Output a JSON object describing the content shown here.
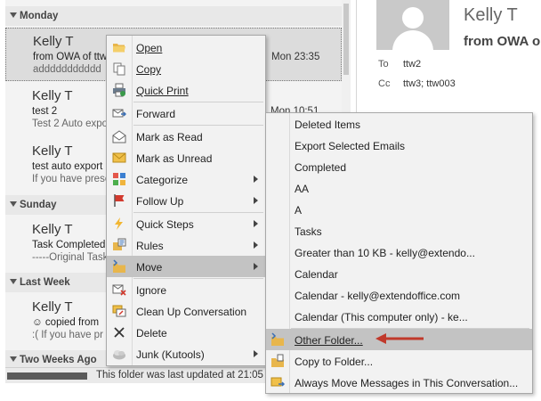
{
  "mail_list": {
    "groups": [
      {
        "label": "Monday"
      },
      {
        "label": "Sunday"
      },
      {
        "label": "Last Week"
      },
      {
        "label": "Two Weeks Ago"
      }
    ],
    "items": [
      {
        "sender": "Kelly T",
        "subject": "from OWA of ttw",
        "preview": "addddddddddd",
        "time": "Mon 23:35"
      },
      {
        "sender": "Kelly T",
        "subject": "test 2",
        "preview": "Test 2  Auto expo",
        "time": "Mon 10:51"
      },
      {
        "sender": "Kelly T",
        "subject": "test auto export",
        "preview": "If you have prese",
        "time": ""
      },
      {
        "sender": "Kelly T",
        "subject": "Task Completed:",
        "preview": "-----Original Task",
        "time": ""
      },
      {
        "sender": "Kelly T",
        "subject": "☺ copied from",
        "preview": ":(  If you have pr",
        "time": ""
      }
    ]
  },
  "reading_pane": {
    "name": "Kelly T",
    "from": "from OWA o",
    "to_label": "To",
    "to_value": "ttw2",
    "cc_label": "Cc",
    "cc_value": "ttw3; ttw003"
  },
  "status_bar": {
    "text": "This folder was last updated at 21:05"
  },
  "context_menu": {
    "items": [
      {
        "label": "Open",
        "icon": "open-folder-icon"
      },
      {
        "label": "Copy",
        "icon": "copy-icon"
      },
      {
        "label": "Quick Print",
        "icon": "quick-print-icon"
      },
      {
        "label": "Forward",
        "icon": "forward-icon"
      },
      {
        "label": "Mark as Read",
        "icon": "mark-read-icon"
      },
      {
        "label": "Mark as Unread",
        "icon": "mark-unread-icon"
      },
      {
        "label": "Categorize",
        "icon": "categorize-icon"
      },
      {
        "label": "Follow Up",
        "icon": "flag-icon"
      },
      {
        "label": "Quick Steps",
        "icon": "lightning-icon"
      },
      {
        "label": "Rules",
        "icon": "rules-icon"
      },
      {
        "label": "Move",
        "icon": "move-folder-icon"
      },
      {
        "label": "Ignore",
        "icon": "ignore-icon"
      },
      {
        "label": "Clean Up Conversation",
        "icon": "clean-up-icon"
      },
      {
        "label": "Delete",
        "icon": "delete-icon"
      },
      {
        "label": "Junk (Kutools)",
        "icon": "junk-icon"
      }
    ]
  },
  "move_submenu": {
    "items": [
      {
        "label": "Deleted Items"
      },
      {
        "label": "Export Selected Emails"
      },
      {
        "label": "Completed"
      },
      {
        "label": "AA"
      },
      {
        "label": "A"
      },
      {
        "label": "Tasks"
      },
      {
        "label": "Greater than 10 KB - kelly@extendo..."
      },
      {
        "label": "Calendar"
      },
      {
        "label": "Calendar - kelly@extendoffice.com"
      },
      {
        "label": "Calendar (This computer only) - ke..."
      },
      {
        "label": "Other Folder...",
        "icon": "other-folder-icon"
      },
      {
        "label": "Copy to Folder...",
        "icon": "copy-to-folder-icon"
      },
      {
        "label": "Always Move Messages in This Conversation...",
        "icon": "always-move-icon"
      }
    ]
  },
  "colors": {
    "highlight": "#c3c3c3",
    "menu_bg": "#f2f2f2",
    "annotation_arrow": "#c0392b"
  }
}
